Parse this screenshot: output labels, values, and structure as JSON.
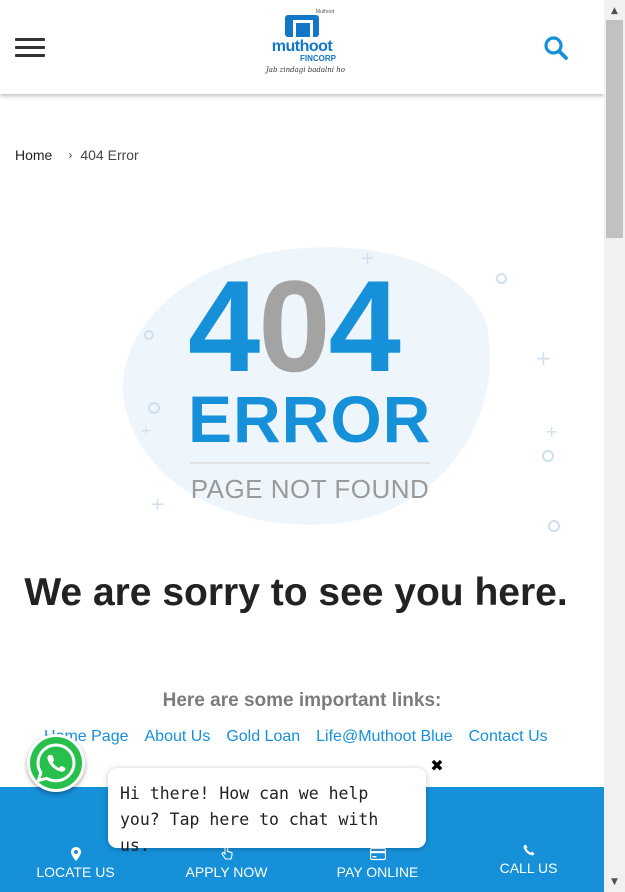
{
  "header": {
    "logo_brand": "muthoot",
    "logo_sub": "FINCORP",
    "logo_top": "Muthoot",
    "logo_tagline": "Jab zindagi badalni ho"
  },
  "breadcrumb": {
    "home": "Home",
    "separator": "›",
    "current": "404 Error"
  },
  "illustration": {
    "digit_left": "4",
    "digit_mid": "0",
    "digit_right": "4",
    "word": "ERROR",
    "subtitle": "PAGE NOT FOUND"
  },
  "main": {
    "sorry_text": "We are sorry to see you here.",
    "links_title": "Here are some important links:",
    "links": [
      "Home Page",
      "About Us",
      "Gold Loan",
      "Life@Muthoot Blue",
      "Contact Us"
    ]
  },
  "chat": {
    "message": "Hi there! How can we help you? Tap here to chat with us.",
    "close_glyph": "✖"
  },
  "bottom_nav": [
    {
      "label": "LOCATE US",
      "icon": "location-pin-icon"
    },
    {
      "label": "APPLY NOW",
      "icon": "hand-pointer-icon"
    },
    {
      "label": "PAY ONLINE",
      "icon": "credit-card-icon"
    },
    {
      "label": "CALL US",
      "icon": "phone-icon"
    }
  ],
  "colors": {
    "brand_blue": "#1590d9",
    "logo_blue": "#1177c6",
    "grey_digit": "#a3a3a3",
    "whatsapp_green": "#27c04d"
  },
  "scrollbar": {
    "up": "▲",
    "down": "▼"
  }
}
